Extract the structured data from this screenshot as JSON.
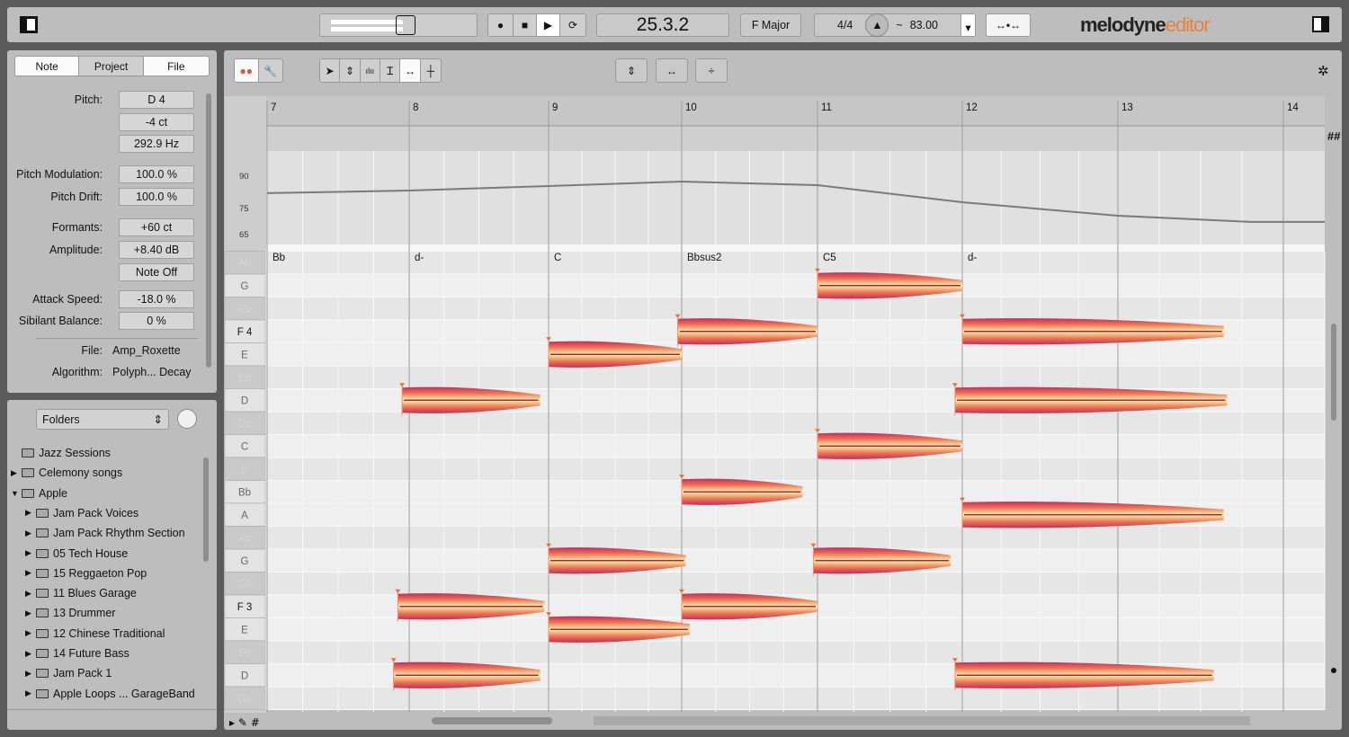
{
  "topbar": {
    "position": "25.3.2",
    "key": "F Major",
    "time_signature": "4/4",
    "tempo_prefix": "~",
    "tempo": "83.00",
    "logo_main": "melodyne",
    "logo_sub": "editor",
    "accent": "#e8823a"
  },
  "inspector": {
    "tabs": [
      "Note",
      "Project",
      "File"
    ],
    "active_tab": "Note",
    "pitch_label": "Pitch:",
    "pitch": "D 4",
    "pitch_cents": "-4 ct",
    "pitch_hz": "292.9 Hz",
    "pitch_mod_label": "Pitch Modulation:",
    "pitch_mod": "100.0 %",
    "pitch_drift_label": "Pitch Drift:",
    "pitch_drift": "100.0 %",
    "formants_label": "Formants:",
    "formants": "+60 ct",
    "amplitude_label": "Amplitude:",
    "amplitude": "+8.40 dB",
    "note_off": "Note Off",
    "attack_label": "Attack Speed:",
    "attack": "-18.0 %",
    "sibilant_label": "Sibilant Balance:",
    "sibilant": "0 %",
    "file_label": "File:",
    "file": "Amp_Roxette",
    "algorithm_label": "Algorithm:",
    "algorithm": "Polyph... Decay"
  },
  "browser": {
    "dropdown": "Folders",
    "items": [
      {
        "label": "Jazz Sessions",
        "level": 0,
        "expander": "none"
      },
      {
        "label": "Celemony songs",
        "level": 0,
        "expander": "collapsed"
      },
      {
        "label": "Apple",
        "level": 0,
        "expander": "expanded"
      },
      {
        "label": "Jam Pack Voices",
        "level": 1,
        "expander": "collapsed"
      },
      {
        "label": "Jam Pack Rhythm Section",
        "level": 1,
        "expander": "collapsed"
      },
      {
        "label": "05 Tech House",
        "level": 1,
        "expander": "collapsed"
      },
      {
        "label": "15 Reggaeton Pop",
        "level": 1,
        "expander": "collapsed"
      },
      {
        "label": "11 Blues Garage",
        "level": 1,
        "expander": "collapsed"
      },
      {
        "label": "13 Drummer",
        "level": 1,
        "expander": "collapsed"
      },
      {
        "label": "12 Chinese Traditional",
        "level": 1,
        "expander": "collapsed"
      },
      {
        "label": "14 Future Bass",
        "level": 1,
        "expander": "collapsed"
      },
      {
        "label": "Jam Pack 1",
        "level": 1,
        "expander": "collapsed"
      },
      {
        "label": "Apple Loops ... GarageBand",
        "level": 1,
        "expander": "collapsed"
      }
    ]
  },
  "editor": {
    "bars": [
      "7",
      "8",
      "9",
      "10",
      "11",
      "12",
      "13",
      "14"
    ],
    "tempo_ticks": [
      "90",
      "75",
      "65"
    ],
    "tempo_curve": [
      {
        "bar": 7,
        "bpm": 81.7
      },
      {
        "bar": 8,
        "bpm": 82.9
      },
      {
        "bar": 9,
        "bpm": 85.0
      },
      {
        "bar": 10,
        "bpm": 87.1
      },
      {
        "bar": 11,
        "bpm": 85.4
      },
      {
        "bar": 12,
        "bpm": 77.5
      },
      {
        "bar": 13,
        "bpm": 71.9
      },
      {
        "bar": 13.8,
        "bpm": 69.5
      },
      {
        "bar": 14.3,
        "bpm": 69.5
      }
    ],
    "chords": [
      {
        "bar": 7,
        "label": "Bb"
      },
      {
        "bar": 8,
        "label": "d-"
      },
      {
        "bar": 9,
        "label": "C"
      },
      {
        "bar": 10,
        "label": "Bbsus2"
      },
      {
        "bar": 11,
        "label": "C5"
      },
      {
        "bar": 12,
        "label": "d-"
      }
    ],
    "keys": [
      "Ab",
      "G",
      "Gb",
      "F 4",
      "E",
      "Eb",
      "D",
      "Db",
      "C",
      "B",
      "Bb",
      "A",
      "Ab",
      "G",
      "Gb",
      "F 3",
      "E",
      "Eb",
      "D",
      "Db"
    ],
    "notes": [
      {
        "pitch": "D4",
        "start": 7.95,
        "end": 8.94
      },
      {
        "pitch": "F3",
        "start": 7.92,
        "end": 8.97
      },
      {
        "pitch": "D3",
        "start": 7.89,
        "end": 8.94
      },
      {
        "pitch": "E4",
        "start": 9.0,
        "end": 10.0
      },
      {
        "pitch": "G3",
        "start": 9.0,
        "end": 10.03
      },
      {
        "pitch": "E3",
        "start": 9.0,
        "end": 10.06
      },
      {
        "pitch": "F4",
        "start": 9.97,
        "end": 11.0
      },
      {
        "pitch": "Bb3",
        "start": 10.0,
        "end": 10.89
      },
      {
        "pitch": "F3",
        "start": 10.0,
        "end": 11.0
      },
      {
        "pitch": "G4",
        "start": 11.0,
        "end": 12.0
      },
      {
        "pitch": "C4",
        "start": 11.0,
        "end": 12.0
      },
      {
        "pitch": "G3",
        "start": 10.97,
        "end": 11.92
      },
      {
        "pitch": "F4",
        "start": 12.0,
        "end": 13.64
      },
      {
        "pitch": "D4",
        "start": 11.95,
        "end": 13.66
      },
      {
        "pitch": "A3",
        "start": 12.0,
        "end": 13.64
      },
      {
        "pitch": "D3",
        "start": 11.95,
        "end": 13.58
      }
    ],
    "blob_colors": {
      "edge": "#c8285a",
      "mid": "#ef7a55",
      "core": "#fbf0b0",
      "line": "#8b1030"
    }
  }
}
